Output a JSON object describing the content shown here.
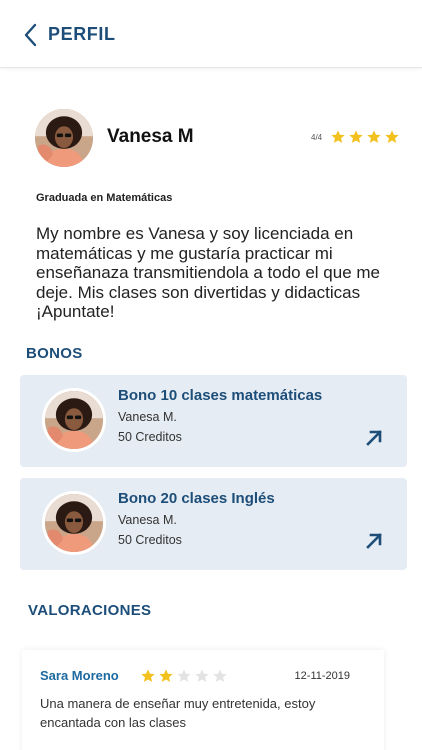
{
  "header": {
    "title": "PERFIL",
    "back_icon": "chevron-left-icon"
  },
  "profile": {
    "name": "Vanesa M",
    "rating_text": "4/4",
    "stars": {
      "filled": 4,
      "total": 4
    },
    "degree": "Graduada en Matemáticas",
    "bio": "My nombre es Vanesa y soy licenciada en matemáticas y me gustaría practicar mi enseñanaza transmitiendola a todo el que me deje. Mis clases son divertidas y didacticas ¡Apuntate!"
  },
  "bonos": {
    "title": "BONOS",
    "items": [
      {
        "title": "Bono 10 clases matemáticas",
        "teacher": "Vanesa M.",
        "credits": "50 Creditos"
      },
      {
        "title": "Bono 20 clases Inglés",
        "teacher": "Vanesa M.",
        "credits": "50 Creditos"
      }
    ]
  },
  "valoraciones": {
    "title": "VALORACIONES",
    "reviews": [
      {
        "name": "Sara Moreno",
        "stars": {
          "filled": 2,
          "total": 5
        },
        "date": "12-11-2019",
        "text": "Una manera de enseñar muy entretenida, estoy encantada con las clases"
      }
    ]
  },
  "colors": {
    "primary": "#1d4e79",
    "star_filled": "#f2c11d",
    "star_empty": "#e3e3e3",
    "card_bg": "#e6ecf3"
  }
}
